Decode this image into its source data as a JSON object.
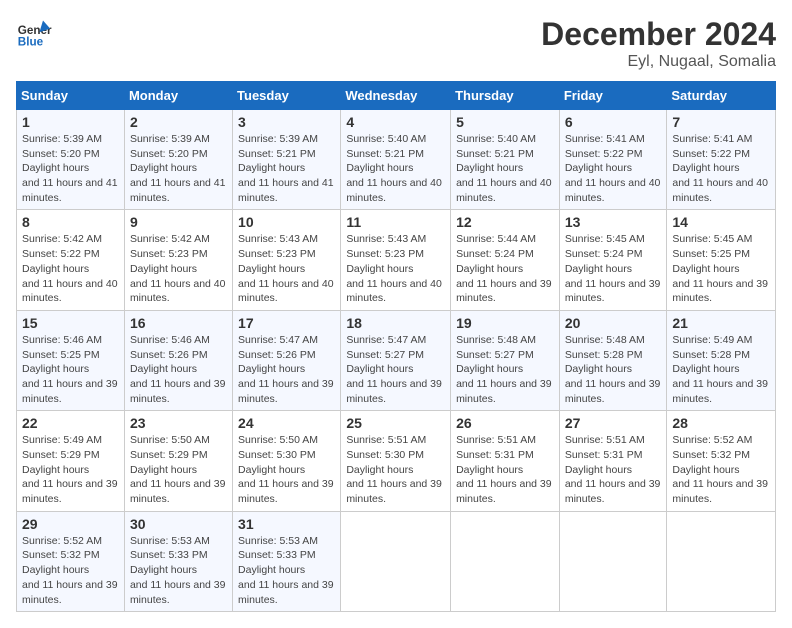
{
  "header": {
    "logo_general": "General",
    "logo_blue": "Blue",
    "month": "December 2024",
    "location": "Eyl, Nugaal, Somalia"
  },
  "weekdays": [
    "Sunday",
    "Monday",
    "Tuesday",
    "Wednesday",
    "Thursday",
    "Friday",
    "Saturday"
  ],
  "weeks": [
    [
      {
        "day": "1",
        "sunrise": "5:39 AM",
        "sunset": "5:20 PM",
        "daylight": "11 hours and 41 minutes."
      },
      {
        "day": "2",
        "sunrise": "5:39 AM",
        "sunset": "5:20 PM",
        "daylight": "11 hours and 41 minutes."
      },
      {
        "day": "3",
        "sunrise": "5:39 AM",
        "sunset": "5:21 PM",
        "daylight": "11 hours and 41 minutes."
      },
      {
        "day": "4",
        "sunrise": "5:40 AM",
        "sunset": "5:21 PM",
        "daylight": "11 hours and 40 minutes."
      },
      {
        "day": "5",
        "sunrise": "5:40 AM",
        "sunset": "5:21 PM",
        "daylight": "11 hours and 40 minutes."
      },
      {
        "day": "6",
        "sunrise": "5:41 AM",
        "sunset": "5:22 PM",
        "daylight": "11 hours and 40 minutes."
      },
      {
        "day": "7",
        "sunrise": "5:41 AM",
        "sunset": "5:22 PM",
        "daylight": "11 hours and 40 minutes."
      }
    ],
    [
      {
        "day": "8",
        "sunrise": "5:42 AM",
        "sunset": "5:22 PM",
        "daylight": "11 hours and 40 minutes."
      },
      {
        "day": "9",
        "sunrise": "5:42 AM",
        "sunset": "5:23 PM",
        "daylight": "11 hours and 40 minutes."
      },
      {
        "day": "10",
        "sunrise": "5:43 AM",
        "sunset": "5:23 PM",
        "daylight": "11 hours and 40 minutes."
      },
      {
        "day": "11",
        "sunrise": "5:43 AM",
        "sunset": "5:23 PM",
        "daylight": "11 hours and 40 minutes."
      },
      {
        "day": "12",
        "sunrise": "5:44 AM",
        "sunset": "5:24 PM",
        "daylight": "11 hours and 39 minutes."
      },
      {
        "day": "13",
        "sunrise": "5:45 AM",
        "sunset": "5:24 PM",
        "daylight": "11 hours and 39 minutes."
      },
      {
        "day": "14",
        "sunrise": "5:45 AM",
        "sunset": "5:25 PM",
        "daylight": "11 hours and 39 minutes."
      }
    ],
    [
      {
        "day": "15",
        "sunrise": "5:46 AM",
        "sunset": "5:25 PM",
        "daylight": "11 hours and 39 minutes."
      },
      {
        "day": "16",
        "sunrise": "5:46 AM",
        "sunset": "5:26 PM",
        "daylight": "11 hours and 39 minutes."
      },
      {
        "day": "17",
        "sunrise": "5:47 AM",
        "sunset": "5:26 PM",
        "daylight": "11 hours and 39 minutes."
      },
      {
        "day": "18",
        "sunrise": "5:47 AM",
        "sunset": "5:27 PM",
        "daylight": "11 hours and 39 minutes."
      },
      {
        "day": "19",
        "sunrise": "5:48 AM",
        "sunset": "5:27 PM",
        "daylight": "11 hours and 39 minutes."
      },
      {
        "day": "20",
        "sunrise": "5:48 AM",
        "sunset": "5:28 PM",
        "daylight": "11 hours and 39 minutes."
      },
      {
        "day": "21",
        "sunrise": "5:49 AM",
        "sunset": "5:28 PM",
        "daylight": "11 hours and 39 minutes."
      }
    ],
    [
      {
        "day": "22",
        "sunrise": "5:49 AM",
        "sunset": "5:29 PM",
        "daylight": "11 hours and 39 minutes."
      },
      {
        "day": "23",
        "sunrise": "5:50 AM",
        "sunset": "5:29 PM",
        "daylight": "11 hours and 39 minutes."
      },
      {
        "day": "24",
        "sunrise": "5:50 AM",
        "sunset": "5:30 PM",
        "daylight": "11 hours and 39 minutes."
      },
      {
        "day": "25",
        "sunrise": "5:51 AM",
        "sunset": "5:30 PM",
        "daylight": "11 hours and 39 minutes."
      },
      {
        "day": "26",
        "sunrise": "5:51 AM",
        "sunset": "5:31 PM",
        "daylight": "11 hours and 39 minutes."
      },
      {
        "day": "27",
        "sunrise": "5:51 AM",
        "sunset": "5:31 PM",
        "daylight": "11 hours and 39 minutes."
      },
      {
        "day": "28",
        "sunrise": "5:52 AM",
        "sunset": "5:32 PM",
        "daylight": "11 hours and 39 minutes."
      }
    ],
    [
      {
        "day": "29",
        "sunrise": "5:52 AM",
        "sunset": "5:32 PM",
        "daylight": "11 hours and 39 minutes."
      },
      {
        "day": "30",
        "sunrise": "5:53 AM",
        "sunset": "5:33 PM",
        "daylight": "11 hours and 39 minutes."
      },
      {
        "day": "31",
        "sunrise": "5:53 AM",
        "sunset": "5:33 PM",
        "daylight": "11 hours and 39 minutes."
      },
      null,
      null,
      null,
      null
    ]
  ]
}
